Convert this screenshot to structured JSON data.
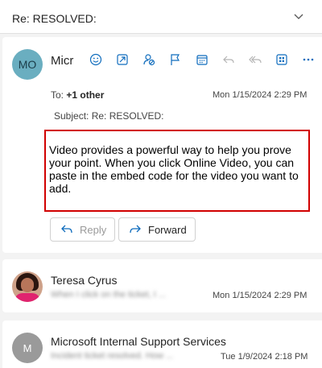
{
  "subject_bar": {
    "title": "Re: RESOLVED:"
  },
  "message": {
    "avatar_initials": "MO",
    "sender_truncated": "Micr",
    "to_label": "To:",
    "to_value": "+1 other",
    "date": "Mon 1/15/2024 2:29 PM",
    "subject_line": "Subject: Re: RESOLVED:",
    "body": "Video provides a powerful way to help you prove your point. When you click Online Video, you can paste in the embed code for the video you want to add.",
    "reply_label": "Reply",
    "forward_label": "Forward"
  },
  "toolbar_icons": [
    "emoji-icon",
    "immersive-reader-icon",
    "sensitivity-icon",
    "flag-icon",
    "calendar-icon",
    "reply-icon",
    "reply-all-icon",
    "apps-icon",
    "more-icon"
  ],
  "thread": [
    {
      "name": "Teresa Cyrus",
      "preview": "When I click on the ticket, I ...",
      "date": "Mon 1/15/2024 2:29 PM"
    },
    {
      "initials": "M",
      "name": "Microsoft Internal Support Services",
      "preview": "Incident ticket resolved. How ...",
      "date": "Tue 1/9/2024 2:18 PM"
    }
  ],
  "colors": {
    "highlight_border": "#d10000",
    "accent": "#0f6cbd",
    "avatar_mo": "#6aaec0"
  }
}
